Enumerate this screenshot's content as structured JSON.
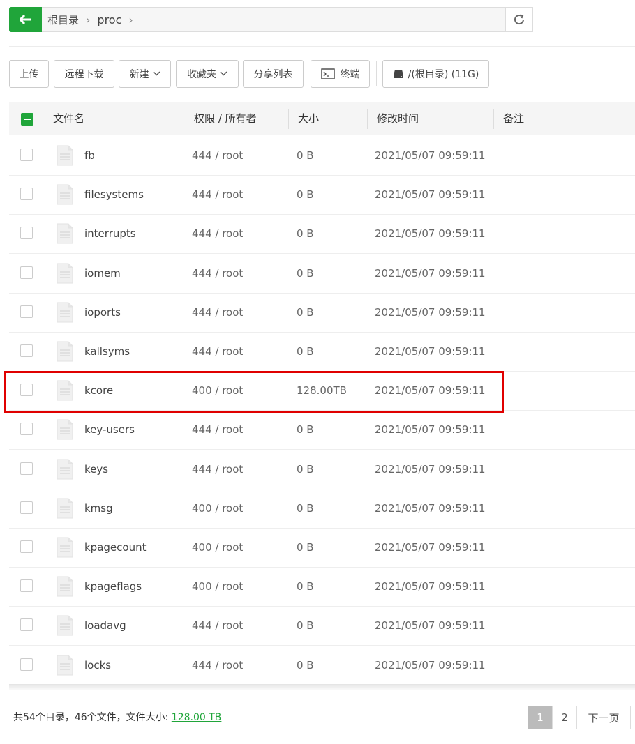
{
  "path": {
    "crumbs": [
      "根目录",
      "proc"
    ]
  },
  "toolbar": {
    "upload": "上传",
    "remote_download": "远程下载",
    "new": "新建",
    "favorites": "收藏夹",
    "share_list": "分享列表",
    "terminal": "终端",
    "disk": "/(根目录) (11G)"
  },
  "table": {
    "headers": {
      "name": "文件名",
      "perm": "权限 / 所有者",
      "size": "大小",
      "mtime": "修改时间",
      "note": "备注"
    },
    "rows": [
      {
        "name": "fb",
        "perm": "444 / root",
        "size": "0 B",
        "mtime": "2021/05/07 09:59:11"
      },
      {
        "name": "filesystems",
        "perm": "444 / root",
        "size": "0 B",
        "mtime": "2021/05/07 09:59:11"
      },
      {
        "name": "interrupts",
        "perm": "444 / root",
        "size": "0 B",
        "mtime": "2021/05/07 09:59:11"
      },
      {
        "name": "iomem",
        "perm": "444 / root",
        "size": "0 B",
        "mtime": "2021/05/07 09:59:11"
      },
      {
        "name": "ioports",
        "perm": "444 / root",
        "size": "0 B",
        "mtime": "2021/05/07 09:59:11"
      },
      {
        "name": "kallsyms",
        "perm": "444 / root",
        "size": "0 B",
        "mtime": "2021/05/07 09:59:11"
      },
      {
        "name": "kcore",
        "perm": "400 / root",
        "size": "128.00TB",
        "mtime": "2021/05/07 09:59:11"
      },
      {
        "name": "key-users",
        "perm": "444 / root",
        "size": "0 B",
        "mtime": "2021/05/07 09:59:11"
      },
      {
        "name": "keys",
        "perm": "444 / root",
        "size": "0 B",
        "mtime": "2021/05/07 09:59:11"
      },
      {
        "name": "kmsg",
        "perm": "400 / root",
        "size": "0 B",
        "mtime": "2021/05/07 09:59:11"
      },
      {
        "name": "kpagecount",
        "perm": "400 / root",
        "size": "0 B",
        "mtime": "2021/05/07 09:59:11"
      },
      {
        "name": "kpageflags",
        "perm": "400 / root",
        "size": "0 B",
        "mtime": "2021/05/07 09:59:11"
      },
      {
        "name": "loadavg",
        "perm": "444 / root",
        "size": "0 B",
        "mtime": "2021/05/07 09:59:11"
      },
      {
        "name": "locks",
        "perm": "444 / root",
        "size": "0 B",
        "mtime": "2021/05/07 09:59:11"
      }
    ]
  },
  "summary": {
    "text": "共54个目录，46个文件，文件大小: ",
    "size": "128.00 TB"
  },
  "pagination": {
    "pages": [
      "1",
      "2"
    ],
    "current": "1",
    "next": "下一页"
  },
  "colors": {
    "accent": "#20a53a",
    "highlight": "#e00000"
  }
}
